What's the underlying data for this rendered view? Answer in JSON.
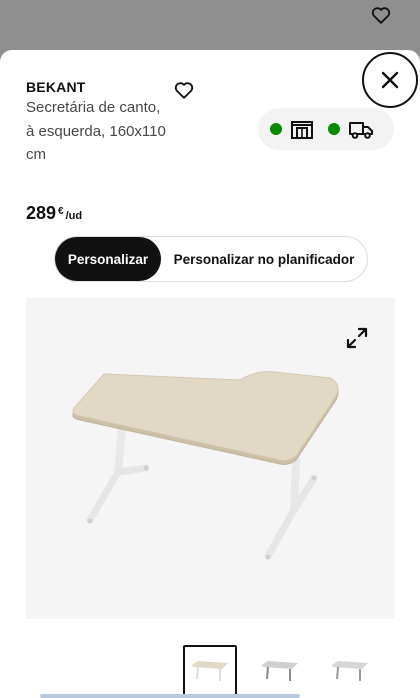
{
  "product": {
    "name": "BEKANT",
    "description": "Secretária de canto, à esquerda, 160x110 cm",
    "price": "289",
    "currency": "€",
    "unit": "/ud"
  },
  "availability": {
    "store_status_color": "#0a8a00",
    "delivery_status_color": "#0a8a00",
    "store_icon": "store-icon",
    "delivery_icon": "truck-icon"
  },
  "actions": {
    "customize_label": "Personalizar",
    "planner_label": "Personalizar no planificador"
  },
  "gallery": {
    "selected_index": 0,
    "thumbnail_count": 3
  }
}
